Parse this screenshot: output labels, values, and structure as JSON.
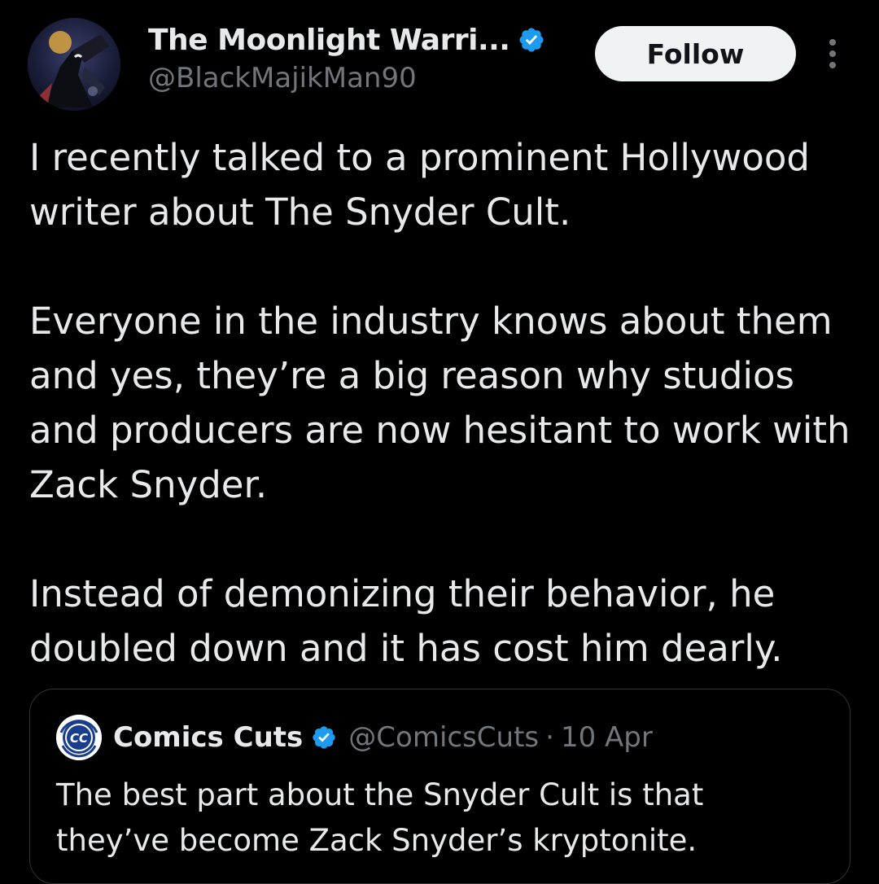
{
  "author": {
    "display_name": "The Moonlight Warri...",
    "handle": "@BlackMajikMan90",
    "verified": true,
    "avatar_icon": "moon-knight-avatar"
  },
  "actions": {
    "follow_label": "Follow",
    "more_icon": "more-vertical-icon"
  },
  "tweet": {
    "paragraphs": [
      "I recently talked to a prominent Hollywood writer about The Snyder Cult.",
      "Everyone in the industry knows about them and yes, they’re a big reason why studios and producers are now hesitant to work with Zack Snyder.",
      "Instead of demonizing their behavior, he doubled down and it has cost him dearly."
    ]
  },
  "quote": {
    "display_name": "Comics Cuts",
    "handle": "@ComicsCuts",
    "separator": "·",
    "date": "10 Apr",
    "verified": true,
    "avatar_logo_text": "CC",
    "text": "The best part about the Snyder Cult is that they’ve become Zack Snyder’s kryptonite."
  },
  "colors": {
    "background": "#000000",
    "primary_text": "#e7e9ea",
    "secondary_text": "#71767b",
    "verified_blue": "#1d9bf0",
    "follow_button_bg": "#eff3f4",
    "border": "#2f3336"
  }
}
